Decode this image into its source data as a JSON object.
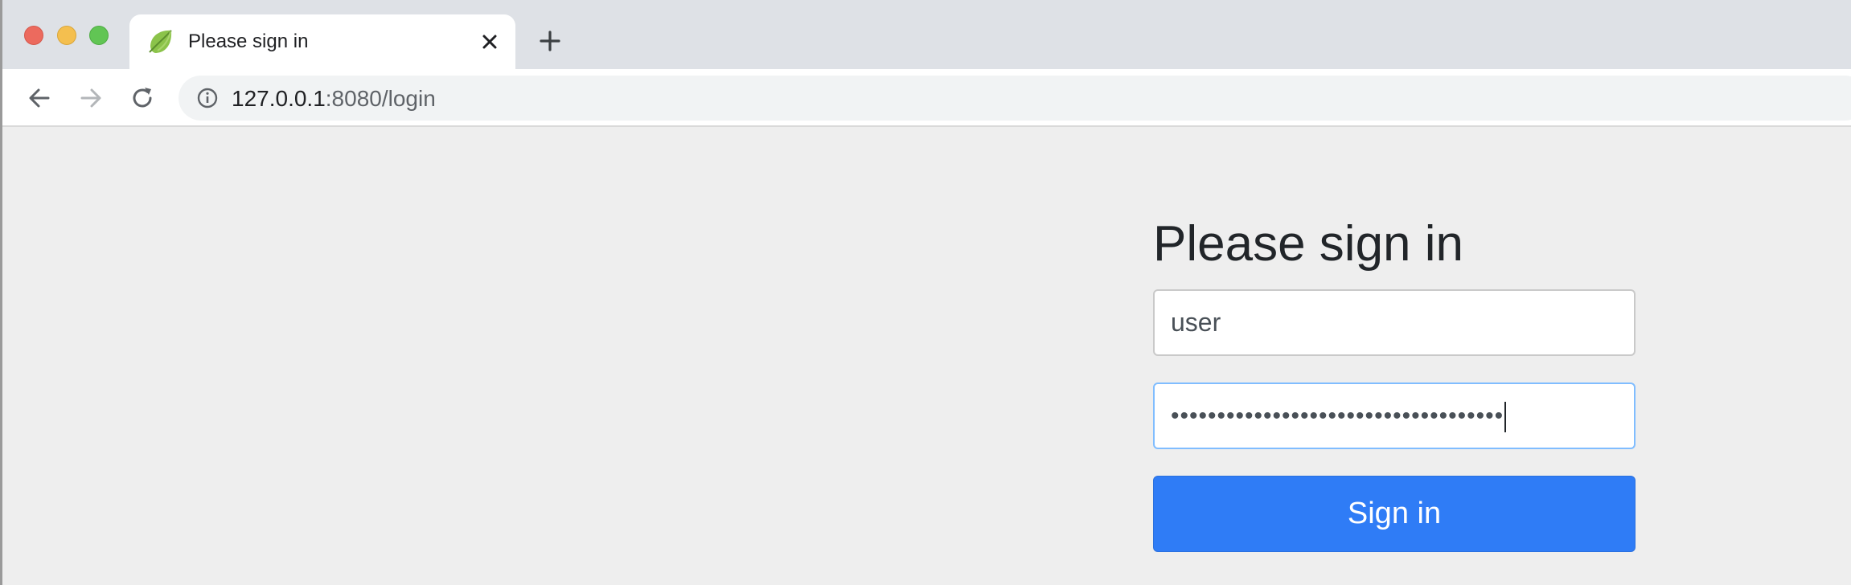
{
  "browser": {
    "tab": {
      "title": "Please sign in",
      "favicon": "spring-leaf-icon"
    },
    "address_bar": {
      "host": "127.0.0.1",
      "rest": ":8080/login"
    },
    "colors": {
      "traffic_close": "#ec6a5e",
      "traffic_minimize": "#f4bf4f",
      "traffic_maximize": "#61c554"
    }
  },
  "login_form": {
    "heading": "Please sign in",
    "username_value": "user",
    "password_masked": "••••••••••••••••••••••••••••••••••••",
    "submit_label": "Sign in",
    "accent_color": "#2f7cf6"
  }
}
